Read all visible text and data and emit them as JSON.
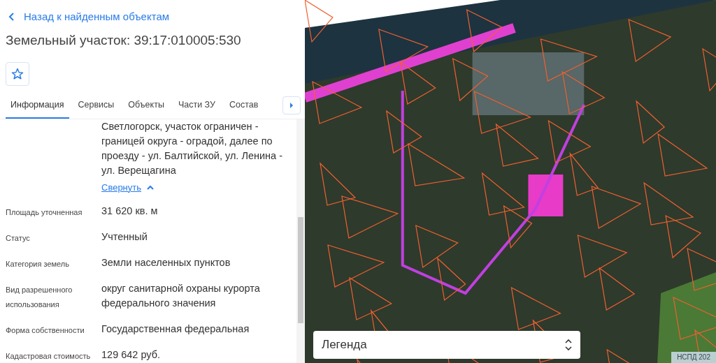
{
  "back_link": "Назад к найденным объектам",
  "title": "Земельный участок: 39:17:010005:530",
  "favorite": {
    "on": false
  },
  "tabs": [
    {
      "label": "Информация",
      "selected": true
    },
    {
      "label": "Сервисы",
      "selected": false
    },
    {
      "label": "Объекты",
      "selected": false
    },
    {
      "label": "Части ЗУ",
      "selected": false
    },
    {
      "label": "Состав",
      "selected": false
    }
  ],
  "partial_value": "Светлогорск, участок ограничен - границей округа - оградой, далее по проезду - ул. Балтийской, ул. Ленина - ул. Верещагина",
  "collapse_link": "Свернуть",
  "properties": [
    {
      "label": "Площадь уточненная",
      "value": "31 620 кв. м"
    },
    {
      "label": "Статус",
      "value": "Учтенный"
    },
    {
      "label": "Категория земель",
      "value": "Земли населенных пунктов"
    },
    {
      "label": "Вид разрешенного использования",
      "value": "округ санитарной охраны курорта федерального значения"
    },
    {
      "label": "Форма собственности",
      "value": "Государственная федеральная"
    },
    {
      "label": "Кадастровая стоимость",
      "value": "129 642 руб."
    }
  ],
  "legend": {
    "label": "Легенда"
  },
  "map_attribution": "НСПД 202"
}
